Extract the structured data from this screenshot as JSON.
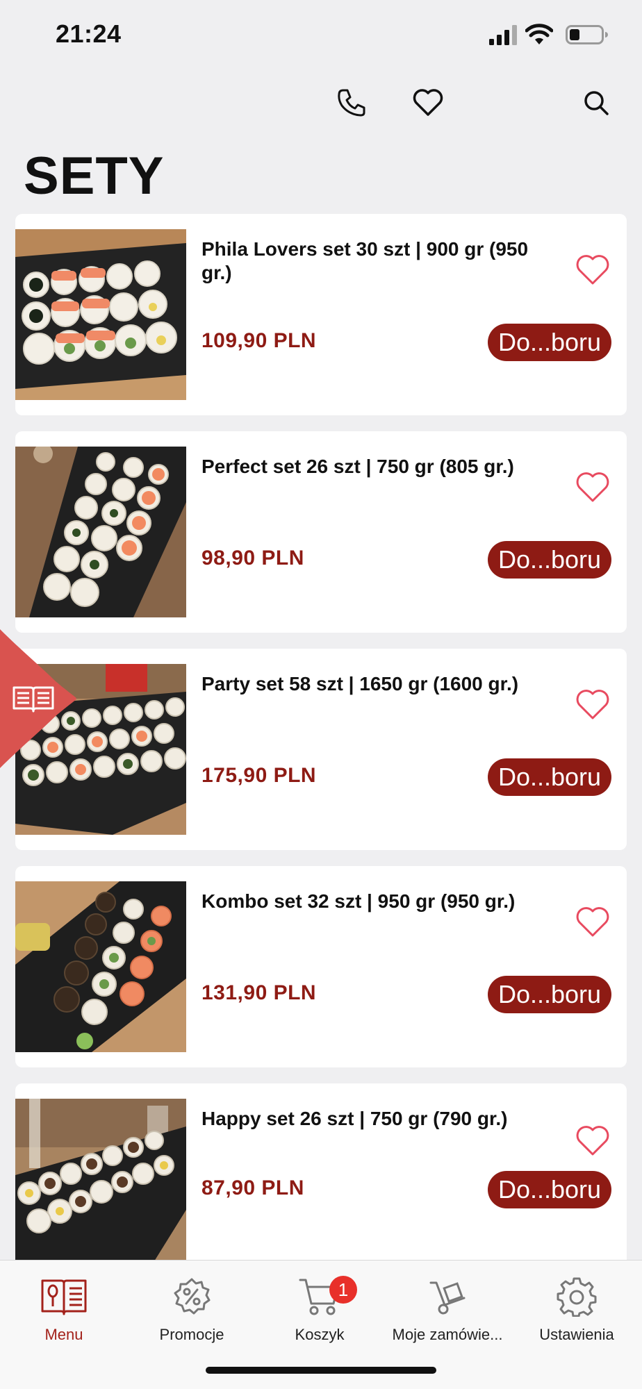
{
  "status_bar": {
    "time": "21:24"
  },
  "header": {
    "actions": [
      {
        "icon": "phone-icon"
      },
      {
        "icon": "heart-icon"
      },
      {
        "icon": "search-icon"
      }
    ]
  },
  "page": {
    "title": "SETY"
  },
  "products": [
    {
      "name": "Phila Lovers set 30 szt | 900 gr (950 gr.)",
      "price": "109,90 PLN",
      "button": "Do...boru",
      "image": "sushi-set-photo"
    },
    {
      "name": "Perfect set 26 szt | 750 gr (805 gr.)",
      "price": "98,90 PLN",
      "button": "Do...boru",
      "image": "sushi-set-photo"
    },
    {
      "name": "Party set 58 szt | 1650 gr (1600 gr.)",
      "price": "175,90 PLN",
      "button": "Do...boru",
      "image": "sushi-set-photo"
    },
    {
      "name": "Kombo set 32 szt | 950 gr (950 gr.)",
      "price": "131,90 PLN",
      "button": "Do...boru",
      "image": "sushi-set-photo"
    },
    {
      "name": "Happy set 26 szt | 750 gr (790 gr.)",
      "price": "87,90 PLN",
      "button": "Do...boru",
      "image": "sushi-set-photo"
    }
  ],
  "side_tab": {
    "icon": "menu-book-icon"
  },
  "bottom_nav": {
    "items": [
      {
        "label": "Menu",
        "icon": "menu-book-icon",
        "active": true
      },
      {
        "label": "Promocje",
        "icon": "discount-badge-icon",
        "active": false
      },
      {
        "label": "Koszyk",
        "icon": "cart-icon",
        "active": false,
        "badge": "1"
      },
      {
        "label": "Moje zamówie...",
        "icon": "hand-truck-icon",
        "active": false
      },
      {
        "label": "Ustawienia",
        "icon": "gear-icon",
        "active": false
      }
    ]
  },
  "colors": {
    "accent": "#8e1b14",
    "side_tab": "#d9534f",
    "badge": "#e8302a",
    "background": "#efeff1"
  }
}
